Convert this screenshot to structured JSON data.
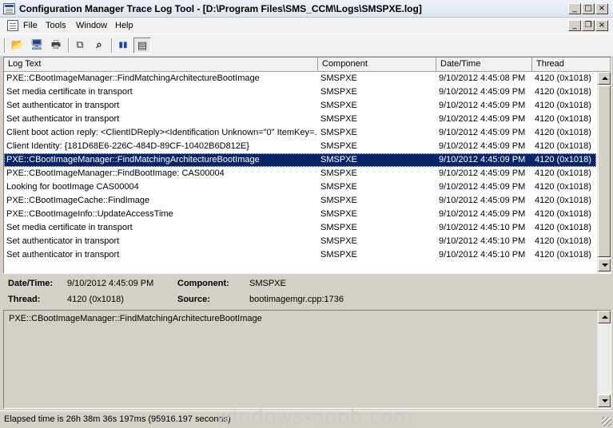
{
  "window": {
    "title": "Configuration Manager Trace Log Tool - [D:\\Program Files\\SMS_CCM\\Logs\\SMSPXE.log]",
    "controls": {
      "minimize": "_",
      "maximize": "□",
      "close": "×",
      "restore": "❐"
    }
  },
  "menu": {
    "file": "File",
    "tools": "Tools",
    "window": "Window",
    "help": "Help"
  },
  "toolbar": {
    "open_icon": "📂",
    "monitor_icon": "🖥",
    "print_icon": "🖶",
    "copy_icon": "⧉",
    "find_icon": "⌕",
    "pause_icon": "▮▮",
    "split_icon": "▤"
  },
  "columns": {
    "log_text": "Log Text",
    "component": "Component",
    "datetime": "Date/Time",
    "thread": "Thread"
  },
  "rows": [
    {
      "text": "PXE::CBootImageManager::FindMatchingArchitectureBootImage",
      "component": "SMSPXE",
      "datetime": "9/10/2012 4:45:08 PM",
      "thread": "4120 (0x1018)"
    },
    {
      "text": "Set media certificate in transport",
      "component": "SMSPXE",
      "datetime": "9/10/2012 4:45:09 PM",
      "thread": "4120 (0x1018)"
    },
    {
      "text": "Set authenticator in transport",
      "component": "SMSPXE",
      "datetime": "9/10/2012 4:45:09 PM",
      "thread": "4120 (0x1018)"
    },
    {
      "text": "Set authenticator in transport",
      "component": "SMSPXE",
      "datetime": "9/10/2012 4:45:09 PM",
      "thread": "4120 (0x1018)"
    },
    {
      "text": "Client boot action reply: <ClientIDReply><Identification Unknown=\"0\" ItemKey=...",
      "component": "SMSPXE",
      "datetime": "9/10/2012 4:45:09 PM",
      "thread": "4120 (0x1018)"
    },
    {
      "text": "Client Identity: {181D68E6-226C-484D-89CF-10402B6D812E}",
      "component": "SMSPXE",
      "datetime": "9/10/2012 4:45:09 PM",
      "thread": "4120 (0x1018)"
    },
    {
      "text": "PXE::CBootImageManager::FindMatchingArchitectureBootImage",
      "component": "SMSPXE",
      "datetime": "9/10/2012 4:45:09 PM",
      "thread": "4120 (0x1018)"
    },
    {
      "text": "PXE::CBootImageManager::FindBootImage: CAS00004",
      "component": "SMSPXE",
      "datetime": "9/10/2012 4:45:09 PM",
      "thread": "4120 (0x1018)"
    },
    {
      "text": "Looking for bootImage CAS00004",
      "component": "SMSPXE",
      "datetime": "9/10/2012 4:45:09 PM",
      "thread": "4120 (0x1018)"
    },
    {
      "text": "PXE::CBootImageCache::FindImage",
      "component": "SMSPXE",
      "datetime": "9/10/2012 4:45:09 PM",
      "thread": "4120 (0x1018)"
    },
    {
      "text": "PXE::CBootImageInfo::UpdateAccessTime",
      "component": "SMSPXE",
      "datetime": "9/10/2012 4:45:09 PM",
      "thread": "4120 (0x1018)"
    },
    {
      "text": "Set media certificate in transport",
      "component": "SMSPXE",
      "datetime": "9/10/2012 4:45:10 PM",
      "thread": "4120 (0x1018)"
    },
    {
      "text": "Set authenticator in transport",
      "component": "SMSPXE",
      "datetime": "9/10/2012 4:45:10 PM",
      "thread": "4120 (0x1018)"
    },
    {
      "text": "Set authenticator in transport",
      "component": "SMSPXE",
      "datetime": "9/10/2012 4:45:10 PM",
      "thread": "4120 (0x1018)"
    }
  ],
  "selected_row": 6,
  "details": {
    "datetime_label": "Date/Time:",
    "datetime_value": "9/10/2012 4:45:09 PM",
    "component_label": "Component:",
    "component_value": "SMSPXE",
    "thread_label": "Thread:",
    "thread_value": "4120 (0x1018)",
    "source_label": "Source:",
    "source_value": "bootimagemgr.cpp:1736"
  },
  "detail_text": "PXE::CBootImageManager::FindMatchingArchitectureBootImage",
  "status": "Elapsed time is 26h 38m 36s 197ms (95916.197 seconds)",
  "watermark": "windows-noob.com",
  "colors": {
    "selection": "#0a246a",
    "chrome": "#d4d0c8",
    "pause_icon": "#1c3fa8"
  }
}
